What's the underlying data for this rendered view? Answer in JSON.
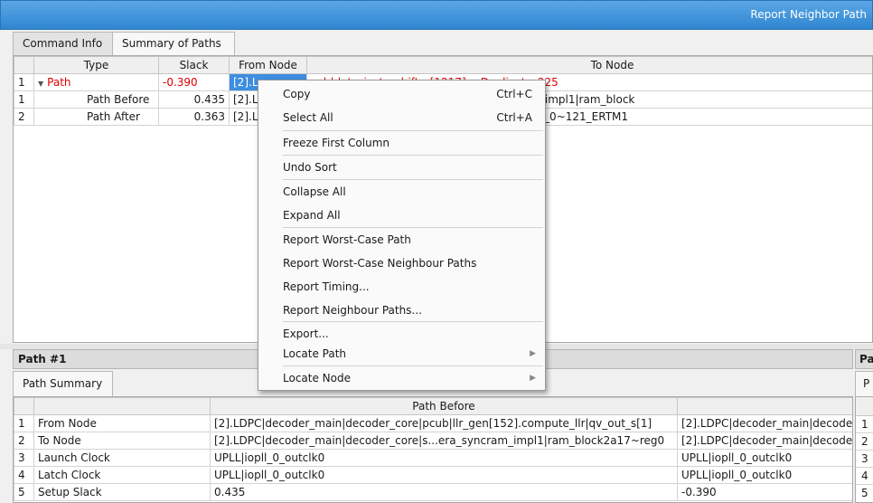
{
  "window": {
    "title": "Report Neighbor Path"
  },
  "tabs": [
    "Command Info",
    "Summary of Paths"
  ],
  "summary": {
    "columns": [
      "Type",
      "Slack",
      "From Node",
      "To Node"
    ],
    "rows": [
      {
        "num": "1",
        "type": "Path",
        "slack": "-0.390",
        "from": "[2].L",
        "to": "sub|data_in_to_shifter[1217]~_Duplicate_225"
      },
      {
        "num": "1",
        "type": "Path Before",
        "slack": "0.435",
        "from": "[2].LD",
        "to": "sub|extinfo_r..._generated|altera_syncram_impl1|ram_block"
      },
      {
        "num": "2",
        "type": "Path After",
        "slack": "0.363",
        "from": "[2].L",
        "to": "sub|shifter|lef...[1].dwshifter_slice|shift_left_0~121_ERTM1"
      }
    ]
  },
  "context_menu": {
    "items": [
      {
        "label": "Copy",
        "shortcut": "Ctrl+C"
      },
      {
        "label": "Select All",
        "shortcut": "Ctrl+A"
      },
      {
        "label": "Freeze First Column"
      },
      {
        "label": "Undo Sort"
      },
      {
        "label": "Collapse All"
      },
      {
        "label": "Expand All"
      },
      {
        "label": "Report Worst-Case Path"
      },
      {
        "label": "Report Worst-Case Neighbour Paths"
      },
      {
        "label": "Report Timing..."
      },
      {
        "label": "Report Neighbour Paths..."
      },
      {
        "label": "Export..."
      },
      {
        "label": "Locate Path"
      },
      {
        "label": "Locate Node"
      }
    ]
  },
  "path_panel": {
    "title": "Path #1",
    "tab": "Path Summary",
    "column": "Path Before",
    "rows": [
      {
        "num": "1",
        "name": "From Node",
        "before": "[2].LDPC|decoder_main|decoder_core|pcub|llr_gen[152].compute_llr|qv_out_s[1]",
        "after": "[2].LDPC|decoder_main|decode"
      },
      {
        "num": "2",
        "name": "To Node",
        "before": "[2].LDPC|decoder_main|decoder_core|s...era_syncram_impl1|ram_block2a17~reg0",
        "after": "[2].LDPC|decoder_main|decode"
      },
      {
        "num": "3",
        "name": "Launch Clock",
        "before": "UPLL|iopll_0_outclk0",
        "after": "UPLL|iopll_0_outclk0"
      },
      {
        "num": "4",
        "name": "Latch Clock",
        "before": "UPLL|iopll_0_outclk0",
        "after": "UPLL|iopll_0_outclk0"
      },
      {
        "num": "5",
        "name": "Setup Slack",
        "before": "0.435",
        "after": "-0.390"
      }
    ]
  },
  "right_panel": {
    "title": "Pa",
    "tab": "P",
    "rows": [
      "1",
      "2",
      "3",
      "4",
      "5"
    ]
  }
}
